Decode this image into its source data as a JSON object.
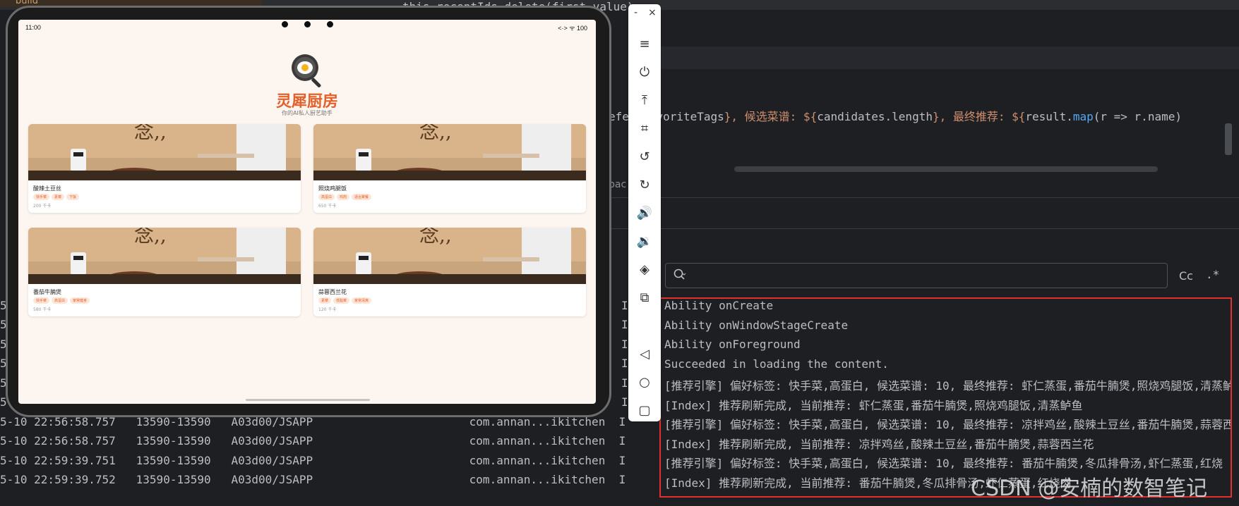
{
  "ide": {
    "code_top": "this.recentIds.delete(first.value);",
    "code_line2_prefix": "efe",
    "code_line2_rest": "e.favoriteTags",
    "code_line2_mid": "}, 候选菜谱: ${",
    "code_line2_cand": "candidates.length",
    "code_line2_mid2": "}, 最终推荐: ${",
    "code_line2_result": "result.",
    "code_line2_map": "map",
    "code_line2_tail": "(r => r.name)",
    "breadcrumb": "bac   map()",
    "search": {
      "placeholder": "",
      "case_label": "Cc",
      "regex_label": ".*"
    }
  },
  "log_left": [
    {
      "text": "5",
      "type": "I"
    },
    {
      "text": "5",
      "type": "I"
    },
    {
      "text": "5",
      "type": "I"
    },
    {
      "text": "5",
      "type": "I"
    },
    {
      "text": "5",
      "type": "I"
    },
    {
      "text": "5",
      "type": "I"
    },
    {
      "text": "5-10 22:56:58.757   13590-13590   A03d00/JSAPP                       com.annan...ikitchen  I",
      "type": "I"
    },
    {
      "text": "5-10 22:56:58.757   13590-13590   A03d00/JSAPP                       com.annan...ikitchen  I",
      "type": "I"
    },
    {
      "text": "5-10 22:59:39.751   13590-13590   A03d00/JSAPP                       com.annan...ikitchen  I",
      "type": "I"
    },
    {
      "text": "5-10 22:59:39.752   13590-13590   A03d00/JSAPP                       com.annan...ikitchen  I",
      "type": "I"
    }
  ],
  "log_messages": [
    "Ability onCreate",
    "Ability onWindowStageCreate",
    "Ability onForeground",
    "Succeeded in loading the content.",
    "[推荐引擎] 偏好标签: 快手菜,高蛋白, 候选菜谱: 10, 最终推荐: 虾仁蒸蛋,番茄牛腩煲,照烧鸡腿饭,清蒸鲈",
    "[Index] 推荐刷新完成, 当前推荐: 虾仁蒸蛋,番茄牛腩煲,照烧鸡腿饭,清蒸鲈鱼",
    "[推荐引擎] 偏好标签: 快手菜,高蛋白, 候选菜谱: 10, 最终推荐: 凉拌鸡丝,酸辣土豆丝,番茄牛腩煲,蒜蓉西",
    "[Index] 推荐刷新完成, 当前推荐: 凉拌鸡丝,酸辣土豆丝,番茄牛腩煲,蒜蓉西兰花",
    "[推荐引擎] 偏好标签: 快手菜,高蛋白, 候选菜谱: 10, 最终推荐: 番茄牛腩煲,冬瓜排骨汤,虾仁蒸蛋,红烧",
    "[Index] 推荐刷新完成, 当前推荐: 番茄牛腩煲,冬瓜排骨汤,虾仁蒸蛋,红烧肉"
  ],
  "watermark": "CSDN @安楠的数智笔记",
  "tablet": {
    "time": "11:00",
    "status_right": "<·> ᯤ 100",
    "app_title": "灵犀厨房",
    "app_subtitle": "你的AI私人厨艺助手",
    "recipes": [
      {
        "name": "酸辣土豆丝",
        "tags": [
          "快手菜",
          "素菜",
          "下饭"
        ],
        "kcal": "200 千卡"
      },
      {
        "name": "照烧鸡腿饭",
        "tags": [
          "高蛋白",
          "鸡肉",
          "适合聚餐"
        ],
        "kcal": "650 千卡"
      },
      {
        "name": "番茄牛腩煲",
        "tags": [
          "快手菜",
          "高蛋白",
          "家常健身"
        ],
        "kcal": "580 千卡"
      },
      {
        "name": "蒜蓉西兰花",
        "tags": [
          "素菜",
          "低脂菜",
          "家常清爽"
        ],
        "kcal": "120 千卡"
      }
    ]
  },
  "emulator_toolbar": {
    "minimize": "-",
    "close": "×",
    "icons": [
      "menu-icon",
      "power-icon",
      "upload-icon",
      "crop-icon",
      "rotate-left-icon",
      "rotate-right-icon",
      "volume-up-icon",
      "volume-down-icon",
      "fold-icon",
      "screenshot-icon",
      "back-icon",
      "home-icon",
      "recent-icon"
    ]
  },
  "colors": {
    "accent": "#e4602a",
    "highlight_border": "#e0302f",
    "ide_bg": "#1e1f22"
  }
}
